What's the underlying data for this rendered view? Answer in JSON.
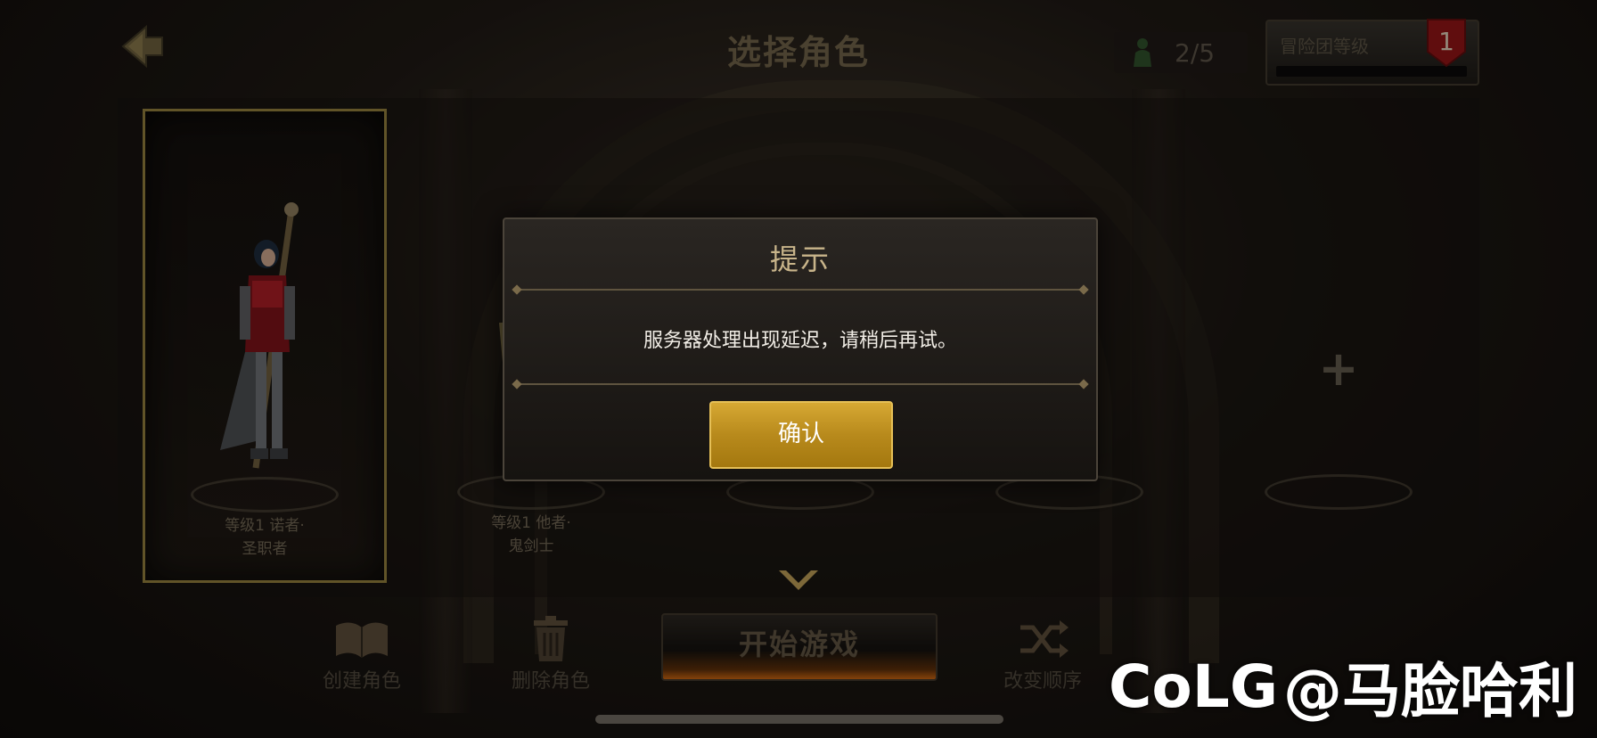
{
  "header": {
    "title": "选择角色",
    "character_count": "2/5",
    "guild_label": "冒险团等级",
    "guild_level": "1"
  },
  "characters": [
    {
      "name_line1": "等级1 诺者·",
      "name_line2": "圣职者",
      "selected": true
    },
    {
      "name_line1": "等级1 他者·",
      "name_line2": "鬼剑士",
      "selected": false
    },
    {
      "empty": true
    },
    {
      "empty": true
    },
    {
      "empty": true,
      "plus": "+"
    }
  ],
  "actions": {
    "create": "创建角色",
    "delete": "删除角色",
    "start": "开始游戏",
    "reorder": "改变顺序"
  },
  "dialog": {
    "title": "提示",
    "message": "服务器处理出现延迟，请稍后再试。",
    "confirm": "确认"
  },
  "watermark": {
    "logo": "CoLG",
    "handle": "@马脸哈利"
  },
  "colors": {
    "confirm_gold": "#c49a26",
    "dialog_title": "#c8b48a",
    "selected_border": "#8f7c3c",
    "guild_badge": "#b4181b"
  }
}
